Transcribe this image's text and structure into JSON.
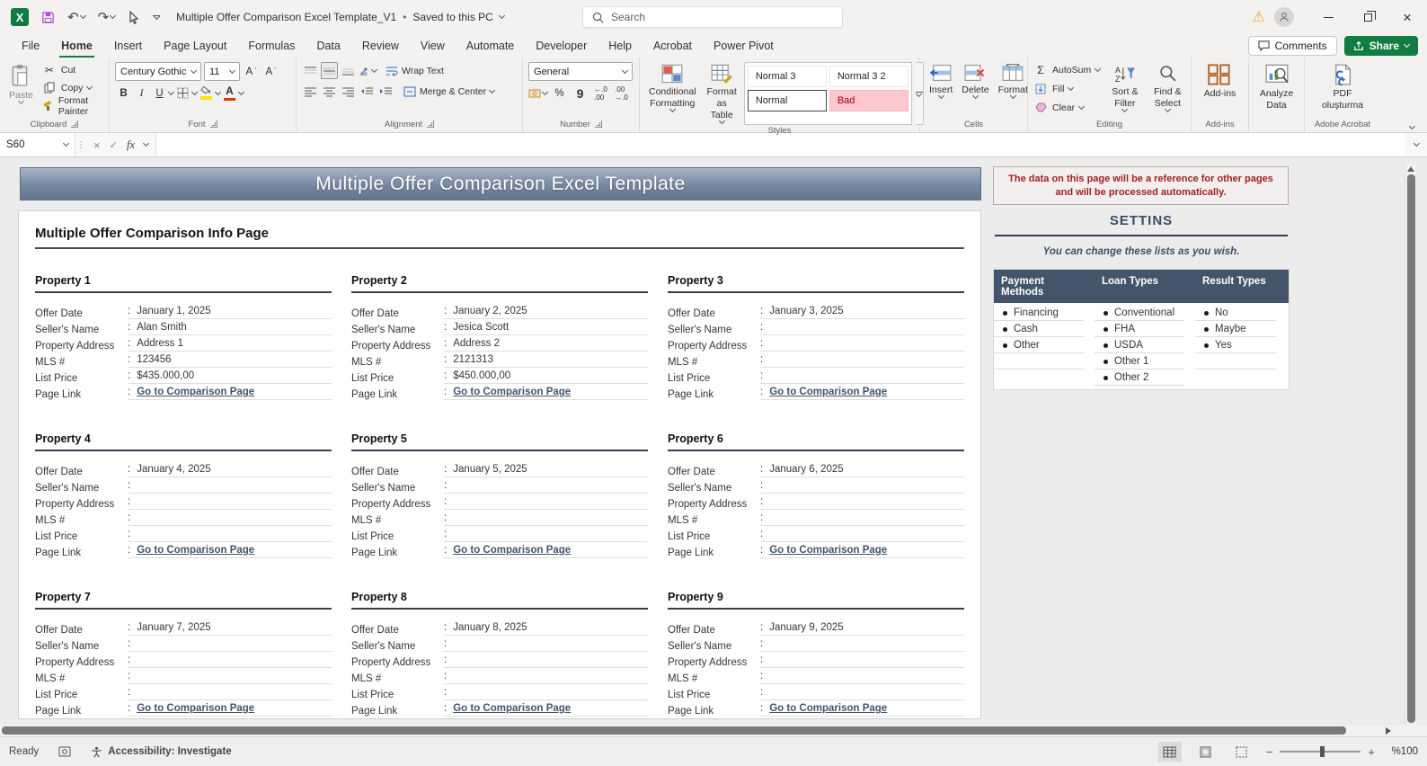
{
  "colors": {
    "excel_green": "#107C41",
    "header_navy": "#44546A",
    "banner_blue": "#76879F",
    "note_red": "#A32020",
    "link_navy": "#44546A",
    "bad_style_bg": "#FFC7CE",
    "bad_style_text": "#9C0006"
  },
  "window": {
    "doc_title": "Multiple Offer Comparison Excel Template_V1",
    "save_status": "Saved to this PC",
    "search_placeholder": "Search",
    "comments_label": "Comments",
    "share_label": "Share"
  },
  "menu_tabs": [
    "File",
    "Home",
    "Insert",
    "Page Layout",
    "Formulas",
    "Data",
    "Review",
    "View",
    "Automate",
    "Developer",
    "Help",
    "Acrobat",
    "Power Pivot"
  ],
  "active_tab": "Home",
  "ribbon": {
    "clipboard": {
      "label": "Clipboard",
      "paste": "Paste",
      "cut": "Cut",
      "copy": "Copy",
      "format_painter": "Format Painter"
    },
    "font": {
      "label": "Font",
      "family": "Century Gothic",
      "size": "11"
    },
    "alignment": {
      "label": "Alignment",
      "wrap_text": "Wrap Text",
      "merge_center": "Merge & Center"
    },
    "number": {
      "label": "Number",
      "format": "General"
    },
    "styles": {
      "label": "Styles",
      "conditional_formatting": "Conditional Formatting",
      "format_as_table": "Format as Table",
      "gallery": [
        {
          "label": "Normal 3",
          "type": "normal"
        },
        {
          "label": "Normal 3 2",
          "type": "normal"
        },
        {
          "label": "Normal",
          "type": "selected"
        },
        {
          "label": "Bad",
          "type": "bad"
        }
      ]
    },
    "cells": {
      "label": "Cells",
      "insert": "Insert",
      "delete": "Delete",
      "format": "Format"
    },
    "editing": {
      "label": "Editing",
      "autosum": "AutoSum",
      "fill": "Fill",
      "clear": "Clear",
      "sort_filter": "Sort & Filter",
      "find_select": "Find & Select"
    },
    "addins": {
      "label": "Add-ins",
      "button": "Add-ins"
    },
    "analyze": {
      "button": "Analyze Data"
    },
    "acrobat": {
      "label": "Adobe Acrobat",
      "button": "PDF oluşturma"
    }
  },
  "formula_bar": {
    "name_box": "S60",
    "fx": "fx"
  },
  "sheet": {
    "banner": "Multiple Offer Comparison Excel Template",
    "note": "The data on this page will be a reference for other pages and will be processed automatically.",
    "page_heading": "Multiple Offer Comparison Info Page",
    "field_labels": [
      "Offer Date",
      "Seller's Name",
      "Property Address",
      "MLS #",
      "List Price",
      "Page Link"
    ],
    "link_text": "Go to Comparison Page",
    "properties": [
      {
        "title": "Property 1",
        "values": [
          "January 1, 2025",
          "Alan Smith",
          "Address 1",
          "123456",
          "$435.000,00"
        ]
      },
      {
        "title": "Property 2",
        "values": [
          "January 2, 2025",
          "Jesica Scott",
          "Address 2",
          "2121313",
          "$450.000,00"
        ]
      },
      {
        "title": "Property 3",
        "values": [
          "January 3, 2025",
          "",
          "",
          "",
          ""
        ]
      },
      {
        "title": "Property 4",
        "values": [
          "January 4, 2025",
          "",
          "",
          "",
          ""
        ]
      },
      {
        "title": "Property 5",
        "values": [
          "January 5, 2025",
          "",
          "",
          "",
          ""
        ]
      },
      {
        "title": "Property 6",
        "values": [
          "January 6, 2025",
          "",
          "",
          "",
          ""
        ]
      },
      {
        "title": "Property 7",
        "values": [
          "January 7, 2025",
          "",
          "",
          "",
          ""
        ]
      },
      {
        "title": "Property 8",
        "values": [
          "January 8, 2025",
          "",
          "",
          "",
          ""
        ]
      },
      {
        "title": "Property 9",
        "values": [
          "January 9, 2025",
          "",
          "",
          "",
          ""
        ]
      }
    ],
    "settings": {
      "title": "SETTINS",
      "subtitle": "You can change these lists as you wish.",
      "columns": [
        "Payment Methods",
        "Loan Types",
        "Result Types"
      ],
      "lists": [
        [
          "Financing",
          "Cash",
          "Other",
          "",
          ""
        ],
        [
          "Conventional",
          "FHA",
          "USDA",
          "Other 1",
          "Other 2"
        ],
        [
          "No",
          "Maybe",
          "Yes",
          "",
          ""
        ]
      ]
    }
  },
  "status_bar": {
    "ready": "Ready",
    "accessibility": "Accessibility: Investigate",
    "zoom_level": "%100"
  }
}
